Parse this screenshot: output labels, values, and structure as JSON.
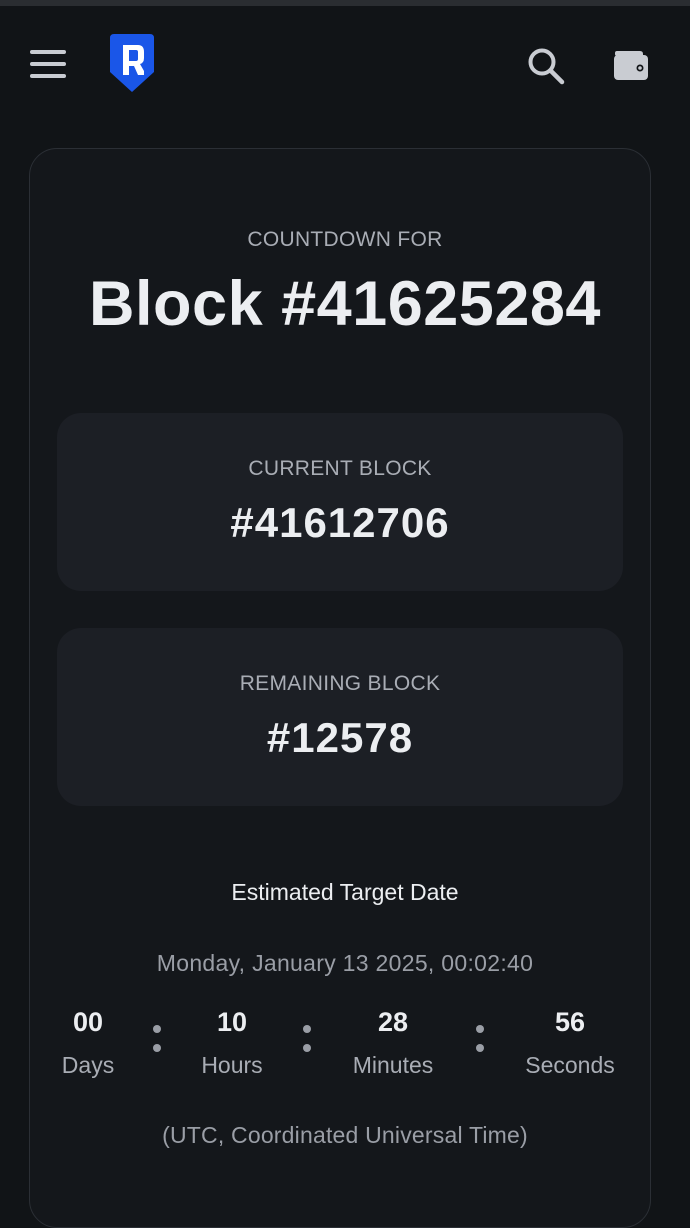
{
  "header": {
    "menu_icon": "hamburger-menu-icon",
    "logo_icon": "ronin-logo-icon",
    "search_icon": "search-icon",
    "wallet_icon": "wallet-icon",
    "brand_color": "#1a56e8"
  },
  "countdown": {
    "label": "COUNTDOWN FOR",
    "target_block": "Block #41625284"
  },
  "current_block": {
    "label": "CURRENT BLOCK",
    "value": "#41612706"
  },
  "remaining_block": {
    "label": "REMAINING BLOCK",
    "value": "#12578"
  },
  "estimate": {
    "title": "Estimated Target Date",
    "date": "Monday, January 13 2025, 00:02:40"
  },
  "timer": [
    {
      "value": "00",
      "unit": "Days"
    },
    {
      "value": "10",
      "unit": "Hours"
    },
    {
      "value": "28",
      "unit": "Minutes"
    },
    {
      "value": "56",
      "unit": "Seconds"
    }
  ],
  "timezone_note": "(UTC, Coordinated Universal Time)"
}
